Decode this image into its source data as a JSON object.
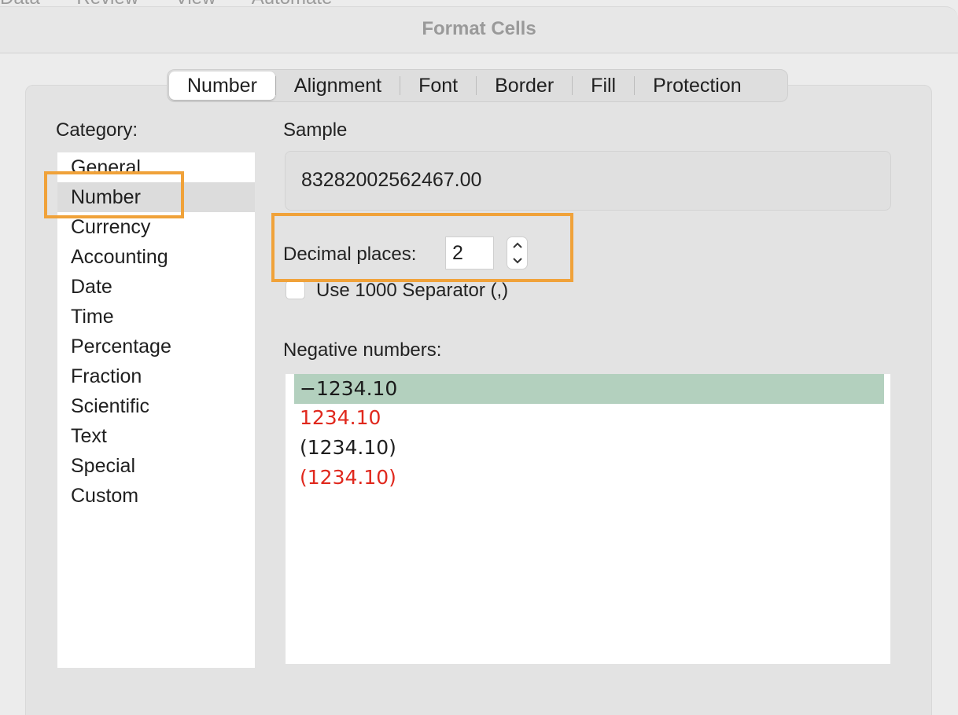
{
  "behind_menu": [
    "Data",
    "Review",
    "View",
    "Automate"
  ],
  "window": {
    "title": "Format Cells"
  },
  "tabs": [
    {
      "label": "Number",
      "active": true
    },
    {
      "label": "Alignment",
      "active": false
    },
    {
      "label": "Font",
      "active": false
    },
    {
      "label": "Border",
      "active": false
    },
    {
      "label": "Fill",
      "active": false
    },
    {
      "label": "Protection",
      "active": false
    }
  ],
  "category": {
    "label": "Category:",
    "items": [
      "General",
      "Number",
      "Currency",
      "Accounting",
      "Date",
      "Time",
      "Percentage",
      "Fraction",
      "Scientific",
      "Text",
      "Special",
      "Custom"
    ],
    "selected": "Number"
  },
  "sample": {
    "label": "Sample",
    "value": "83282002562467.00"
  },
  "decimal_places": {
    "label": "Decimal places:",
    "value": "2"
  },
  "separator": {
    "label": "Use 1000 Separator (,)",
    "checked": false
  },
  "negative_numbers": {
    "label": "Negative numbers:",
    "items": [
      {
        "text": "−1234.10",
        "color": "#1a1a1a",
        "selected": true
      },
      {
        "text": "1234.10",
        "color": "#e0281d",
        "selected": false
      },
      {
        "text": "(1234.10)",
        "color": "#1a1a1a",
        "selected": false
      },
      {
        "text": "(1234.10)",
        "color": "#e0281d",
        "selected": false
      }
    ]
  },
  "colors": {
    "highlight": "#f0a23a",
    "negative_selected_bg": "#b3d0be",
    "red": "#e0281d"
  }
}
